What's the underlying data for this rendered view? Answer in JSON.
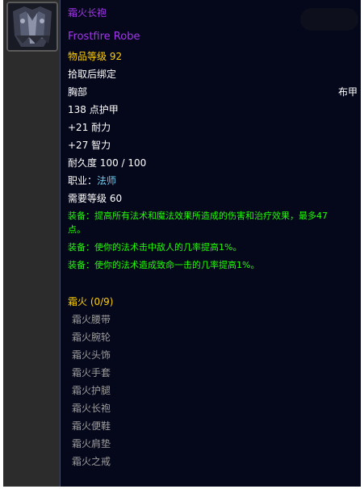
{
  "item": {
    "name_cn": "霜火长袍",
    "name_en": "Frostfire Robe",
    "item_level": "物品等级 92",
    "bind": "拾取后绑定",
    "slot": "胸部",
    "armor_type": "布甲",
    "armor": "138 点护甲",
    "stamina": "+21 耐力",
    "intellect": "+27 智力",
    "durability": "耐久度 100 / 100",
    "class_label": "职业：",
    "class_value": "法师",
    "required_level": "需要等级 60",
    "equip_1_line1": "装备：提高所有法术和魔法效果所造成的伤害和治疗效果，最多47",
    "equip_1_line2": "点。",
    "equip_2": "装备：使你的法术击中敌人的几率提高1%。",
    "equip_3": "装备：使你的法术造成致命一击的几率提高1%。"
  },
  "set": {
    "title": "霜火 (0/9)",
    "pieces": [
      "霜火腰带",
      "霜火腕轮",
      "霜火头饰",
      "霜火手套",
      "霜火护腿",
      "霜火长袍",
      "霜火便鞋",
      "霜火肩垫",
      "霜火之戒"
    ]
  },
  "icon": "robe-icon",
  "colors": {
    "epic": "#a335ee",
    "item_level": "#ffd100",
    "equip": "#1eff00",
    "class_mage": "#69ccf0",
    "set_piece_missing": "#9d9d9d",
    "tooltip_bg": "#05071a"
  }
}
